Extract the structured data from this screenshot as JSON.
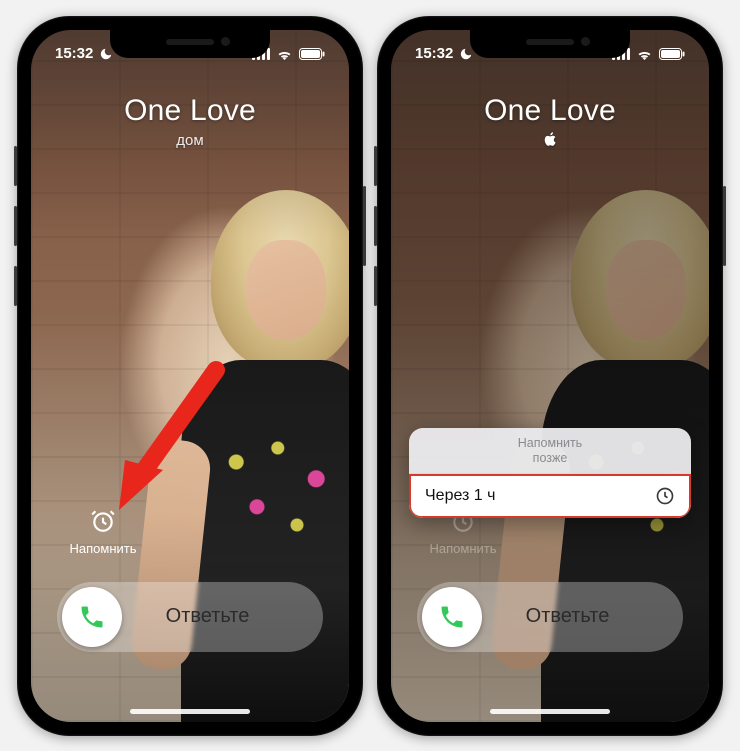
{
  "status": {
    "time": "15:32",
    "dnd_icon": "moon-icon",
    "signal_icon": "cellular-icon",
    "wifi_icon": "wifi-icon",
    "battery_icon": "battery-icon"
  },
  "left_phone": {
    "caller_name": "One Love",
    "caller_label": "дом",
    "remind_label": "Напомнить",
    "answer_label": "Ответьте"
  },
  "right_phone": {
    "caller_name": "One Love",
    "caller_label_icon": "apple-logo",
    "remind_label": "Напомнить",
    "answer_label": "Ответьте",
    "popup": {
      "title_line1": "Напомнить",
      "title_line2": "позже",
      "option_label": "Через 1 ч",
      "option_icon": "clock-icon"
    }
  },
  "annotation": {
    "arrow_color": "#e8261c"
  }
}
